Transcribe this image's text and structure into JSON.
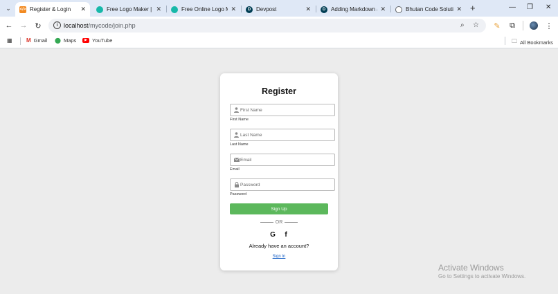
{
  "browser": {
    "tabs": [
      {
        "title": "Register & Login",
        "active": true,
        "favicon": "code-favicon",
        "color": "#f28a22"
      },
      {
        "title": "Free Logo Maker | Cr",
        "active": false,
        "favicon": "logo-maker-favicon",
        "color": "#16b8a9"
      },
      {
        "title": "Free Online Logo Ma",
        "active": false,
        "favicon": "logo-maker-favicon",
        "color": "#16b8a9"
      },
      {
        "title": "Devpost",
        "active": false,
        "favicon": "devpost-favicon",
        "color": "#003e54"
      },
      {
        "title": "Adding Markdown a",
        "active": false,
        "favicon": "devpost-favicon",
        "color": "#003e54"
      },
      {
        "title": "Bhutan Code Solutio",
        "active": false,
        "favicon": "globe-favicon",
        "color": "#5f6368"
      }
    ],
    "url_host": "localhost",
    "url_path": "/mycode/join.php",
    "bookmarks": [
      {
        "label": "Gmail",
        "icon": "gmail-icon"
      },
      {
        "label": "Maps",
        "icon": "maps-icon"
      },
      {
        "label": "YouTube",
        "icon": "youtube-icon"
      }
    ],
    "all_bookmarks": "All Bookmarks"
  },
  "form": {
    "title": "Register",
    "fields": [
      {
        "placeholder": "First Name",
        "label": "First Name",
        "icon": "user-icon"
      },
      {
        "placeholder": "Last Name",
        "label": "Last Name",
        "icon": "user-icon"
      },
      {
        "placeholder": "Email",
        "label": "Email",
        "icon": "envelope-icon"
      },
      {
        "placeholder": "Password",
        "label": "Password",
        "icon": "lock-icon"
      }
    ],
    "signup_label": "Sign Up",
    "or_text": "OR",
    "social": [
      {
        "glyph": "G",
        "icon": "google-icon"
      },
      {
        "glyph": "f",
        "icon": "facebook-icon"
      }
    ],
    "already_text": "Already have an account?",
    "signin_label": "Sign In",
    "accent_color": "#5cb85c",
    "link_color": "#1a62c7"
  },
  "watermark": {
    "line1": "Activate Windows",
    "line2": "Go to Settings to activate Windows."
  }
}
